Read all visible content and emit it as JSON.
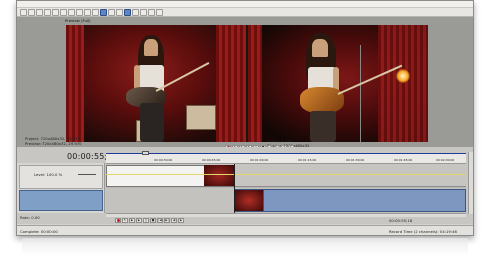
{
  "menu": [
    "File",
    "Edit",
    "View",
    "Insert",
    "Tools",
    "Options",
    "Help"
  ],
  "preview": {
    "mode_label": "Preview (Full)",
    "project_line": "Project:   720x480x32, 29.970",
    "preview_line": "Preview:  720x480x32, 29.970",
    "frame_line": "Frame:      1,049",
    "display_line": "Display:    1240x480x32"
  },
  "timeline": {
    "timecode": "00:00:55;18",
    "ruler_marks": [
      "00:00:30;00",
      "00:00:45;00",
      "00:01:00;00",
      "00:01:15;00",
      "00:01:30;00",
      "00:01:45;00",
      "00:02:00;00"
    ],
    "track1_level": "Level: 100.0 %",
    "rate": "Rate: 0.00",
    "record_time": "00:00:55;18"
  },
  "status": {
    "left": "Complete: 00:00:00",
    "right": "Record Time (2 channels): 04:19:46"
  },
  "colors": {
    "accent": "#1d3d9a",
    "track_blue": "#7f9fc6",
    "record": "#c41d1d"
  }
}
